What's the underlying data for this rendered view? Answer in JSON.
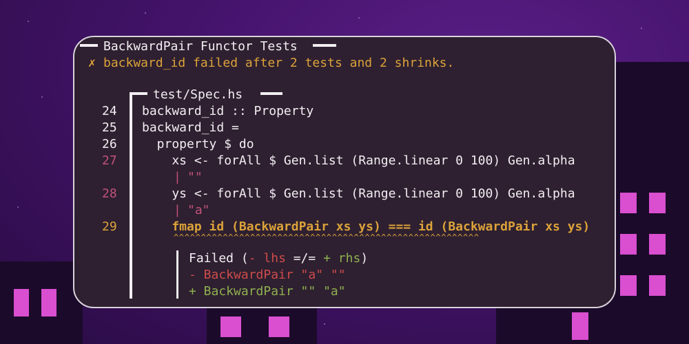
{
  "header": {
    "title": "BackwardPair Functor Tests"
  },
  "failure_message": {
    "icon": "✗",
    "text": "backward_id failed after 2 tests and 2 shrinks."
  },
  "file": {
    "name": "test/Spec.hs"
  },
  "code_lines": [
    {
      "num": "24",
      "text": "backward_id :: Property"
    },
    {
      "num": "25",
      "text": "backward_id ="
    },
    {
      "num": "26",
      "text": "  property $ do"
    },
    {
      "num": "27",
      "text": "    xs <- forAll $ Gen.list (Range.linear 0 100) Gen.alpha"
    },
    {
      "num": "28",
      "text": "    ys <- forAll $ Gen.list (Range.linear 0 100) Gen.alpha"
    },
    {
      "num": "29",
      "text": "    fmap id (BackwardPair xs ys) === id (BackwardPair xs ys)"
    }
  ],
  "annotations": {
    "xs_value": "\"\"",
    "ys_value": "\"a\"",
    "carets": "^^^^^^^^^^^^^^^^^^^^^^^^^^^^^^^^^^^^^^^^^^^^^^^^^^^^^^^^"
  },
  "diff": {
    "failed_prefix": "Failed (",
    "minus_sign": "-",
    "lhs": "lhs",
    "neq": "=/=",
    "plus_sign": "+",
    "rhs": "rhs",
    "close": ")",
    "minus_line": "- BackwardPair \"a\" \"\"",
    "plus_line": "+ BackwardPair \"\" \"a\""
  },
  "colors": {
    "accent_orange": "#dca23a",
    "diff_red": "#cf4b4b",
    "diff_green": "#8fb050",
    "line_pink": "#c2527a",
    "terminal_bg": "#2e2030"
  }
}
